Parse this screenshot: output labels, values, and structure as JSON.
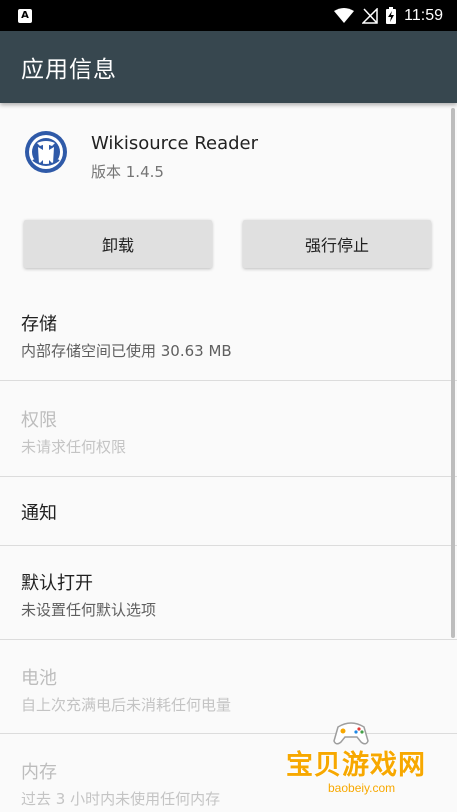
{
  "status_bar": {
    "notification_letter": "A",
    "time": "11:59"
  },
  "app_bar": {
    "title": "应用信息"
  },
  "app": {
    "name": "Wikisource Reader",
    "version": "版本 1.4.5"
  },
  "buttons": {
    "uninstall": "卸载",
    "force_stop": "强行停止"
  },
  "items": [
    {
      "title": "存储",
      "subtitle": "内部存储空间已使用 30.63 MB",
      "enabled": true
    },
    {
      "title": "权限",
      "subtitle": "未请求任何权限",
      "enabled": false
    },
    {
      "title": "通知",
      "subtitle": "",
      "enabled": true
    },
    {
      "title": "默认打开",
      "subtitle": "未设置任何默认选项",
      "enabled": true
    },
    {
      "title": "电池",
      "subtitle": "自上次充满电后未消耗任何电量",
      "enabled": false
    },
    {
      "title": "内存",
      "subtitle": "过去 3 小时内未使用任何内存",
      "enabled": false
    }
  ],
  "watermark": {
    "text": "宝贝游戏网",
    "url": "baobeiy.com"
  },
  "colors": {
    "app_bar": "#37474f",
    "status_bar": "#000000",
    "background": "#fafafa",
    "button": "#e0e0e0",
    "watermark": "#f7a800"
  }
}
